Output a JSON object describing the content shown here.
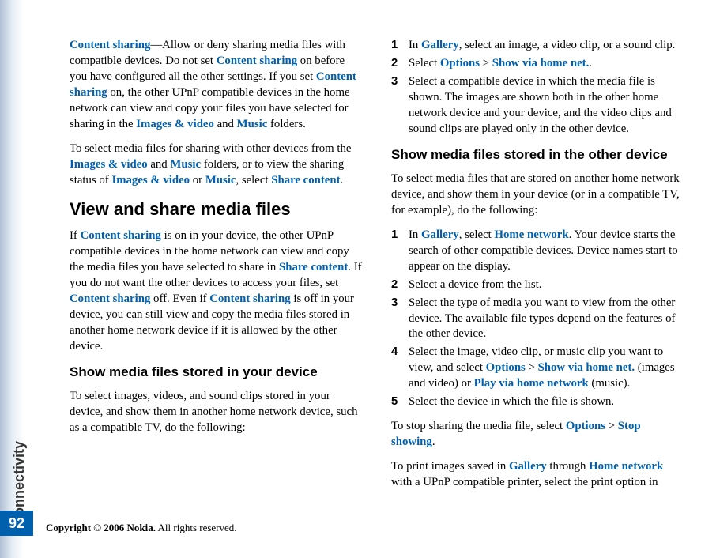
{
  "sidebar": {
    "label": "Connectivity"
  },
  "page_number": "92",
  "footer": {
    "copyright": "Copyright © 2006 Nokia.",
    "rights": " All rights reserved."
  },
  "left": {
    "p1a": "Content sharing",
    "p1b": "—Allow or deny sharing media files with compatible devices. Do not set ",
    "p1c": "Content sharing",
    "p1d": " on before you have configured all the other settings. If you set ",
    "p1e": "Content sharing",
    "p1f": " on, the other UPnP compatible devices in the home network can view and copy your files you have selected for sharing in the ",
    "p1g": "Images & video",
    "p1h": " and ",
    "p1i": "Music",
    "p1j": " folders.",
    "p2a": "To select media files for sharing with other devices from the ",
    "p2b": "Images & video",
    "p2c": " and ",
    "p2d": "Music",
    "p2e": " folders, or to view the sharing status of ",
    "p2f": "Images & video",
    "p2g": " or ",
    "p2h": "Music",
    "p2i": ", select ",
    "p2j": "Share content",
    "p2k": ".",
    "h2": "View and share media files",
    "p3a": "If ",
    "p3b": "Content sharing",
    "p3c": " is on in your device, the other UPnP compatible devices in the home network can view and copy the media files you have selected to share in ",
    "p3d": "Share content",
    "p3e": ". If you do not want the other devices to access your files, set ",
    "p3f": "Content sharing",
    "p3g": " off. Even if ",
    "p3h": "Content sharing",
    "p3i": " is off in your device, you can still view and copy the media files stored in another home network device if it is allowed by the other device.",
    "h3": "Show media files stored in your device",
    "p4": "To select images, videos, and sound clips stored in your device, and show them in another home network device, such as a compatible TV, do the following:"
  },
  "right": {
    "li1a": "In ",
    "li1b": "Gallery",
    "li1c": ", select an image, a video clip, or a sound clip.",
    "li2a": "Select ",
    "li2b": "Options",
    "li2c": " > ",
    "li2d": "Show via home net.",
    "li2e": ".",
    "li3": "Select a compatible device in which the media file is shown. The images are shown both in the other home network device and your device, and the video clips and sound clips are played only in the other device.",
    "h3": "Show media files stored in the other device",
    "p1": "To select media files that are stored on another home network device, and show them in your device (or in a compatible TV, for example), do the following:",
    "b1a": "In ",
    "b1b": "Gallery",
    "b1c": ", select ",
    "b1d": "Home network",
    "b1e": ". Your device starts the search of other compatible devices. Device names start to appear on the display.",
    "b2": "Select a device from the list.",
    "b3": "Select the type of media you want to view from the other device. The available file types depend on the features of the other device.",
    "b4a": "Select the image, video clip, or music clip you want to view, and select ",
    "b4b": "Options",
    "b4c": " > ",
    "b4d": "Show via home net.",
    "b4e": " (images and video) or ",
    "b4f": "Play via home network",
    "b4g": " (music).",
    "b5": "Select the device in which the file is shown.",
    "p2a": "To stop sharing the media file, select ",
    "p2b": "Options",
    "p2c": " > ",
    "p2d": "Stop showing",
    "p2e": ".",
    "p3a": "To print images saved in ",
    "p3b": "Gallery",
    "p3c": " through ",
    "p3d": "Home network",
    "p3e": " with a UPnP compatible printer, select the print option in"
  },
  "nums": {
    "n1": "1",
    "n2": "2",
    "n3": "3",
    "n4": "4",
    "n5": "5"
  }
}
